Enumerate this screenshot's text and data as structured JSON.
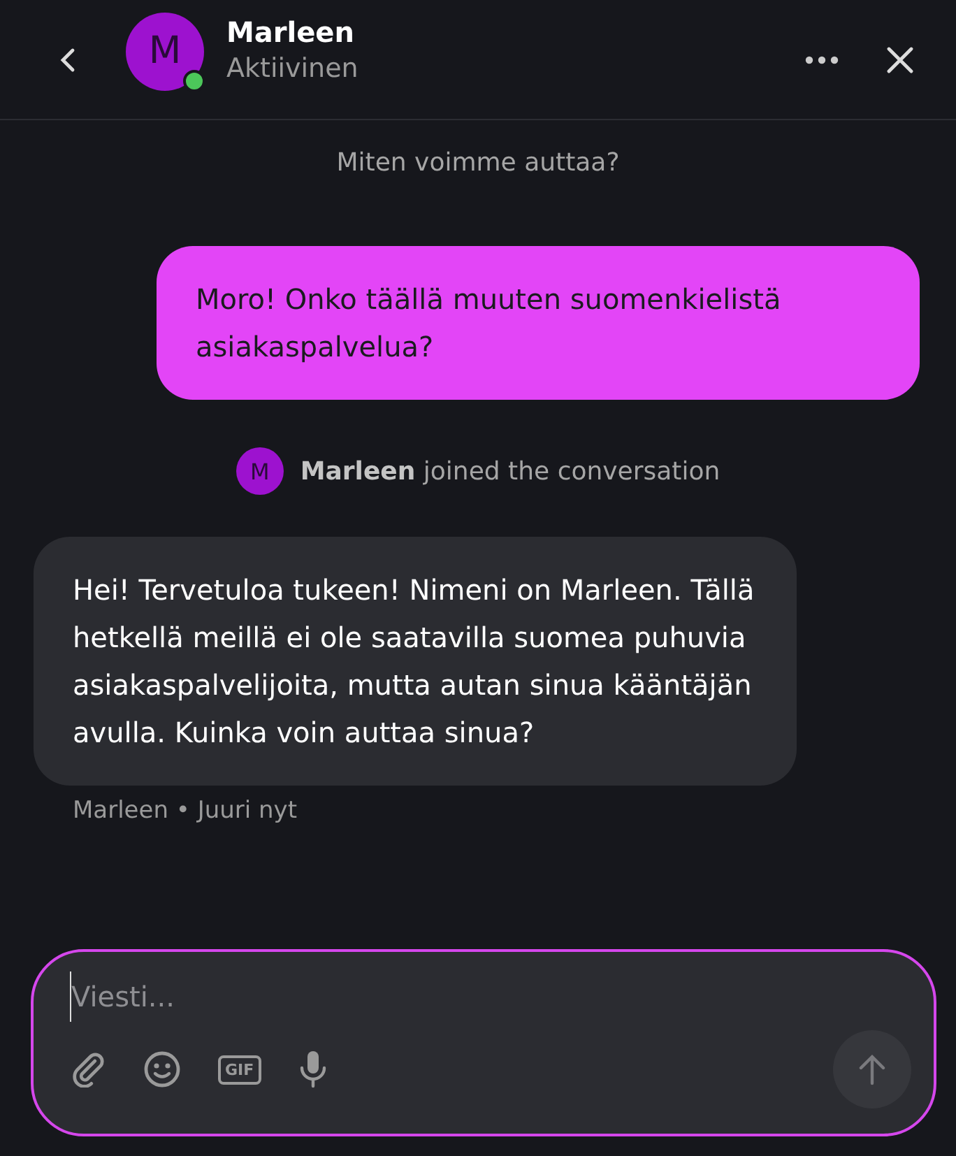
{
  "header": {
    "avatar_letter": "M",
    "name": "Marleen",
    "status": "Aktiivinen",
    "online": true
  },
  "intro": "Miten voimme auttaa?",
  "messages": [
    {
      "kind": "user",
      "text": "Moro! Onko täällä muuten suomenkielistä asiakaspalvelua?"
    },
    {
      "kind": "system",
      "avatar_letter": "M",
      "text": "**Marleen** joined the conversation"
    },
    {
      "kind": "agent",
      "text": "Hei! Tervetuloa tukeen! Nimeni on Marleen. Tällä hetkellä meillä ei ole saatavilla suomea puhuvia asiakaspalvelijoita, mutta autan sinua kääntäjän avulla. Kuinka voin auttaa sinua?",
      "meta": "Marleen • Juuri nyt"
    }
  ],
  "composer": {
    "placeholder": "Viesti...",
    "gif_label": "GIF",
    "send_disabled": true
  }
}
